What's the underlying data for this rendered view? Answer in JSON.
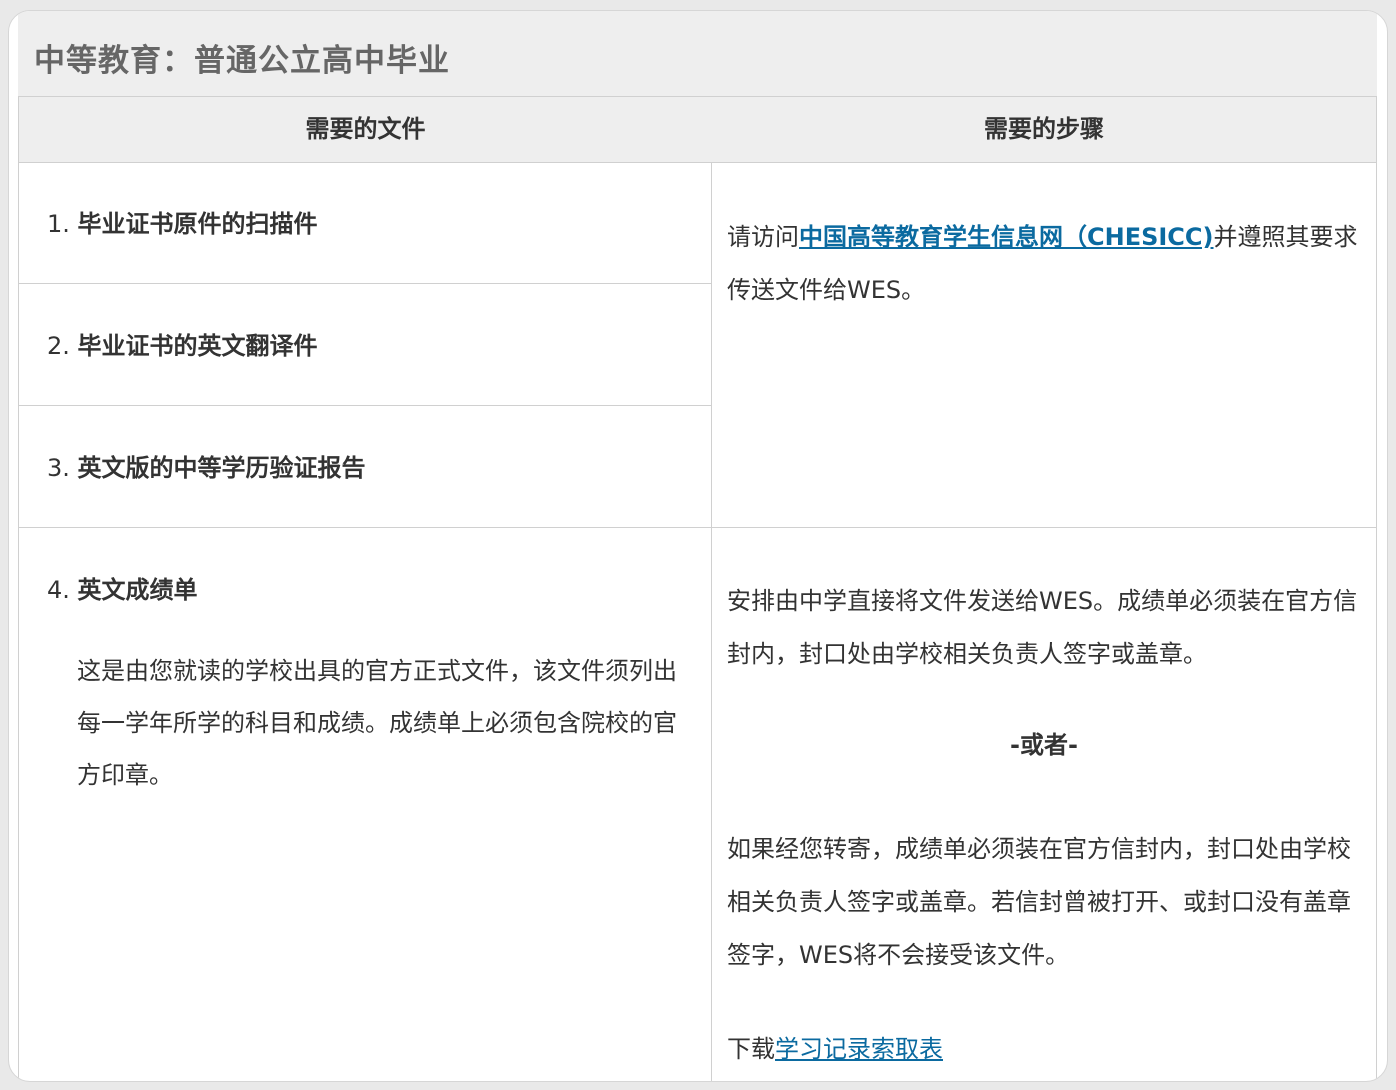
{
  "card": {
    "title": "中等教育：普通公立高中毕业"
  },
  "table": {
    "headers": {
      "documents": "需要的文件",
      "steps": "需要的步骤"
    },
    "documents": [
      {
        "num": "1.",
        "label": "毕业证书原件的扫描件"
      },
      {
        "num": "2.",
        "label": "毕业证书的英文翻译件"
      },
      {
        "num": "3.",
        "label": "英文版的中等学历验证报告"
      },
      {
        "num": "4.",
        "label": "英文成绩单"
      }
    ],
    "transcript_description": "这是由您就读的学校出具的官方正式文件，该文件须列出每一学年所学的科目和成绩。成绩单上必须包含院校的官方印章。",
    "steps": {
      "chesicc_prefix": "请访问",
      "chesicc_link": "中国高等教育学生信息网（CHESICC)",
      "chesicc_suffix": "并遵照其要求传送文件给WES。",
      "school_send": "安排由中学直接将文件发送给WES。成绩单必须装在官方信封内，封口处由学校相关负责人签字或盖章。",
      "or": "-或者-",
      "self_send": "如果经您转寄，成绩单必须装在官方信封内，封口处由学校相关负责人签字或盖章。若信封曾被打开、或封口没有盖章签字，WES将不会接受该文件。",
      "download_prefix": "下载",
      "download_link": "学习记录索取表"
    }
  },
  "colors": {
    "header_bg": "#eeeeee",
    "border": "#d0d0d0",
    "link": "#0b6aa0",
    "title_text": "#666666",
    "body_text": "#333333"
  }
}
